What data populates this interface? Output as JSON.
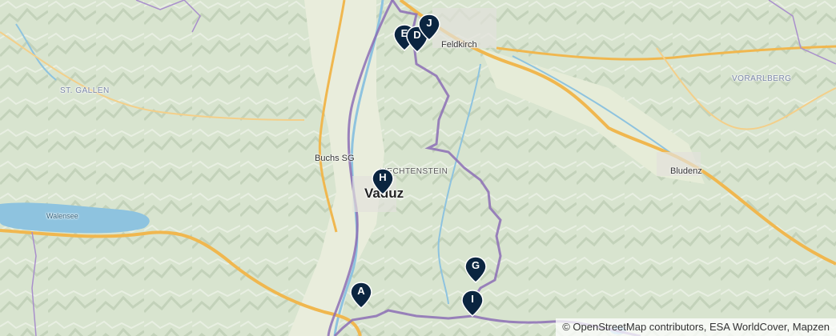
{
  "map": {
    "places": [
      {
        "id": "feldkirch",
        "label": "Feldkirch",
        "kind": "city"
      },
      {
        "id": "st-gallen",
        "label": "ST. GALLEN",
        "kind": "region"
      },
      {
        "id": "vorarlberg",
        "label": "VORARLBERG",
        "kind": "region"
      },
      {
        "id": "buchs",
        "label": "Buchs SG",
        "kind": "city"
      },
      {
        "id": "liechtenstein",
        "label": "LIECHTENSTEIN",
        "kind": "country"
      },
      {
        "id": "vaduz",
        "label": "Vaduz",
        "kind": "capital"
      },
      {
        "id": "bludenz",
        "label": "Bludenz",
        "kind": "city"
      },
      {
        "id": "walensee",
        "label": "Walensee",
        "kind": "water"
      }
    ],
    "markers": [
      {
        "id": "A",
        "label": "A",
        "color": "#0b2540"
      },
      {
        "id": "D",
        "label": "D",
        "color": "#0b2540"
      },
      {
        "id": "E",
        "label": "E",
        "color": "#0b2540"
      },
      {
        "id": "G",
        "label": "G",
        "color": "#0b2540"
      },
      {
        "id": "H",
        "label": "H",
        "color": "#0b2540"
      },
      {
        "id": "I",
        "label": "I",
        "color": "#0b2540"
      },
      {
        "id": "J",
        "label": "J",
        "color": "#0b2540"
      }
    ],
    "attribution": "© OpenStreetMap contributors, ESA WorldCover, Mapzen"
  }
}
